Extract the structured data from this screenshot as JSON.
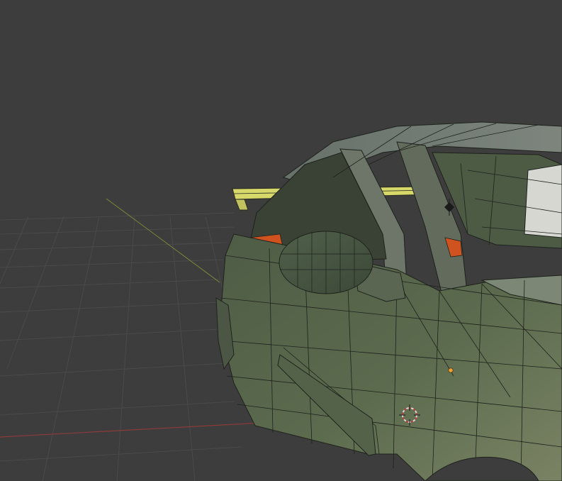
{
  "viewport": {
    "mode": "3d-viewport",
    "shading": "solid",
    "overlay": "wireframe",
    "background_color": "#3d3d3d",
    "grid_color": "#4a4a4a",
    "x_axis_color": "#8a3b3b",
    "y_axis_color": "#7d8a3a"
  },
  "scene": {
    "object": "car-mesh",
    "selected_part": "rear-spoiler",
    "body_color": "#5a6a4c",
    "selection_color": "#d6d86a",
    "interior_accent_color": "#d0521f",
    "origin_color": "#f0a030",
    "cursor_color": "#d8d8d8",
    "cursor_accent_color": "#c23b3b",
    "icons": [
      "3d-cursor-icon",
      "object-origin-icon",
      "light-empty-icon"
    ]
  }
}
